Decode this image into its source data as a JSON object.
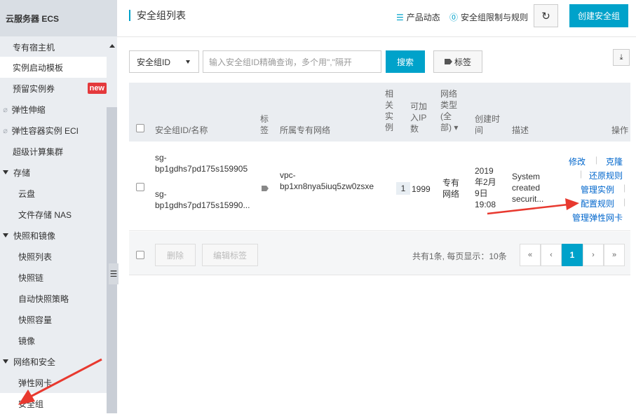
{
  "sidebar": {
    "brand": "云服务器 ECS",
    "items": [
      {
        "label": "专有宿主机"
      },
      {
        "label": "实例启动模板"
      },
      {
        "label": "预留实例券",
        "badge": "new"
      },
      {
        "label": "弹性伸缩"
      },
      {
        "label": "弹性容器实例 ECI"
      },
      {
        "label": "超级计算集群"
      },
      {
        "label": "存储"
      },
      {
        "label": "云盘"
      },
      {
        "label": "文件存储 NAS"
      },
      {
        "label": "快照和镜像"
      },
      {
        "label": "快照列表"
      },
      {
        "label": "快照链"
      },
      {
        "label": "自动快照策略"
      },
      {
        "label": "快照容量"
      },
      {
        "label": "镜像"
      },
      {
        "label": "网络和安全"
      },
      {
        "label": "弹性网卡"
      },
      {
        "label": "安全组"
      }
    ]
  },
  "header": {
    "title": "安全组列表",
    "news_link": "产品动态",
    "limits_link": "安全组限制与规则",
    "create_btn": "创建安全组"
  },
  "toolbar": {
    "select_value": "安全组ID",
    "search_placeholder": "输入安全组ID精确查询，多个用\",\"隔开",
    "search_btn": "搜索",
    "tag_btn": "标签"
  },
  "table": {
    "headers": {
      "name": "安全组ID/名称",
      "tag": [
        "标",
        "签"
      ],
      "vpc": "所属专有网络",
      "instances": [
        "相",
        "关",
        "实",
        "例"
      ],
      "ips": [
        "可加",
        "入IP",
        "数"
      ],
      "net_type": [
        "网络",
        "类型",
        "(全",
        "部) ▾"
      ],
      "created": [
        "创建时",
        "间"
      ],
      "desc": "描述",
      "ops": "操作"
    },
    "row": {
      "id": [
        "sg-",
        "bp1gdhs7pd175s159905"
      ],
      "name": [
        "sg-",
        "bp1gdhs7pd175s15990..."
      ],
      "vpc": [
        "vpc-",
        "bp1xn8nya5iuq5zw0zsxe"
      ],
      "instances": "1",
      "ips": "1999",
      "net_type": [
        "专有",
        "网络"
      ],
      "created": [
        "2019",
        "年2月",
        "9日",
        "19:08"
      ],
      "desc": [
        "System",
        "created",
        "securit..."
      ],
      "ops": {
        "modify": "修改",
        "clone": "克隆",
        "restore": "还原规则",
        "manage_instances": "管理实例",
        "config_rules": "配置规则",
        "manage_eni": "管理弹性网卡"
      }
    }
  },
  "footer": {
    "delete_btn": "删除",
    "edit_tags_btn": "编辑标签",
    "summary": "共有1条, 每页显示：10条",
    "pager": {
      "first": "«",
      "prev": "‹",
      "current": "1",
      "next": "›",
      "last": "»"
    }
  },
  "colors": {
    "accent": "#00a2ca",
    "link": "#0066cc",
    "arrow": "#e8392f"
  }
}
